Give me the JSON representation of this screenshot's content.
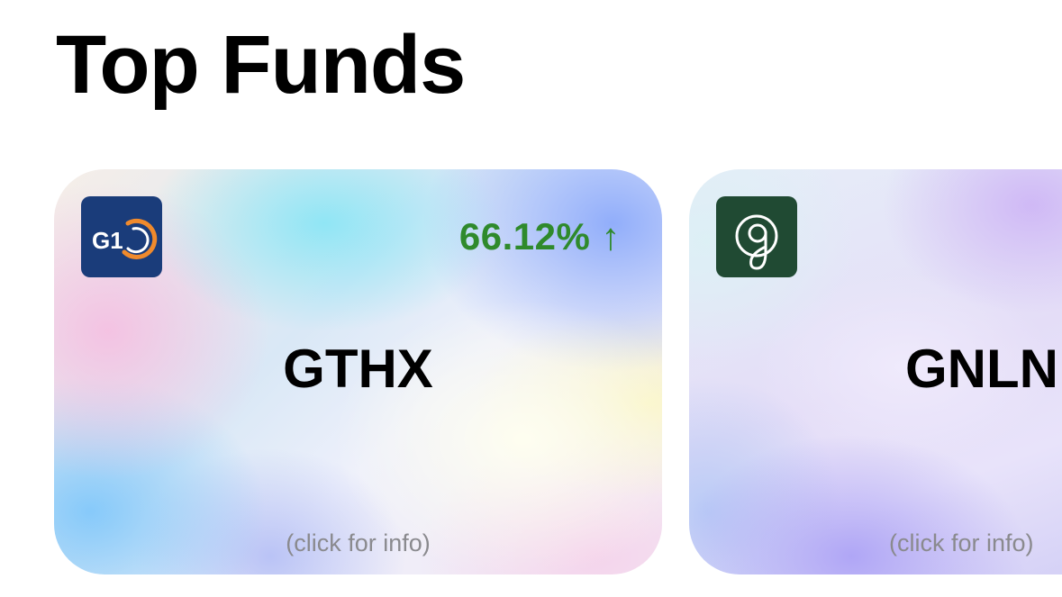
{
  "header": {
    "title": "Top Funds"
  },
  "colors": {
    "positive": "#2f8a2c",
    "hint": "#8a8a8e",
    "logo_1_bg": "#1a3c7a",
    "logo_2_bg": "#204a33"
  },
  "cards": [
    {
      "ticker": "GTHX",
      "change_value": "66.12%",
      "change_arrow": "↑",
      "hint": "(click for info)",
      "logo_icon": "g1-logo-icon",
      "logo_text": "G1"
    },
    {
      "ticker": "GNLN",
      "hint": "(click for info)",
      "logo_icon": "greenlane-g-logo-icon"
    }
  ]
}
